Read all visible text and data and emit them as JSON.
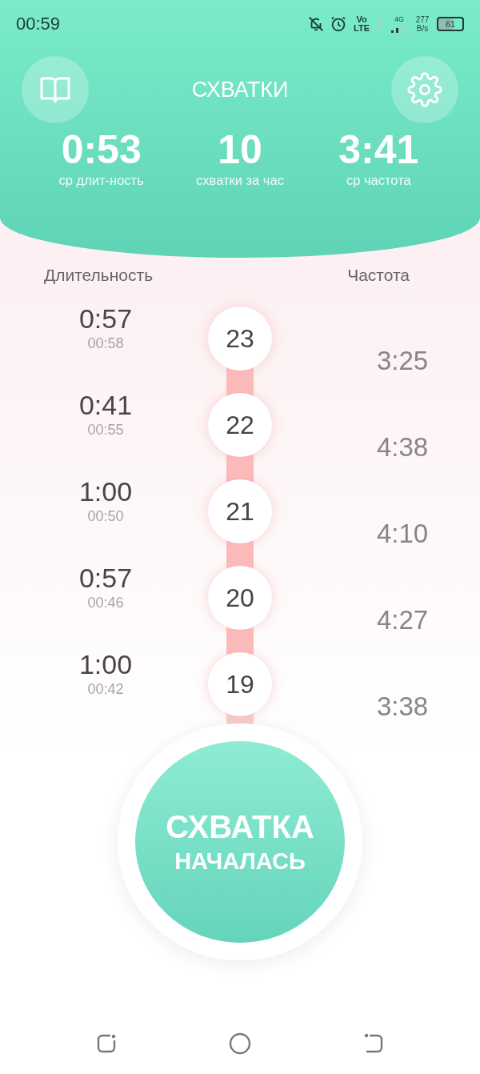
{
  "status_bar": {
    "time": "00:59",
    "network_label": "Vo LTE",
    "network_type": "4G",
    "speed": "277 B/s",
    "battery": "61"
  },
  "header": {
    "title": "СХВАТКИ"
  },
  "stats": [
    {
      "value": "0:53",
      "label": "ср длит-ность"
    },
    {
      "value": "10",
      "label": "схватки за час"
    },
    {
      "value": "3:41",
      "label": "ср частота"
    }
  ],
  "columns": {
    "duration": "Длительность",
    "frequency": "Частота"
  },
  "contractions": [
    {
      "duration": "0:57",
      "start": "00:58",
      "number": "23",
      "interval": "3:25"
    },
    {
      "duration": "0:41",
      "start": "00:55",
      "number": "22",
      "interval": "4:38"
    },
    {
      "duration": "1:00",
      "start": "00:50",
      "number": "21",
      "interval": "4:10"
    },
    {
      "duration": "0:57",
      "start": "00:46",
      "number": "20",
      "interval": "4:27"
    },
    {
      "duration": "1:00",
      "start": "00:42",
      "number": "19",
      "interval": "3:38"
    }
  ],
  "main_button": {
    "line_1": "СХВАТКА",
    "line_2": "НАЧАЛАСЬ"
  }
}
